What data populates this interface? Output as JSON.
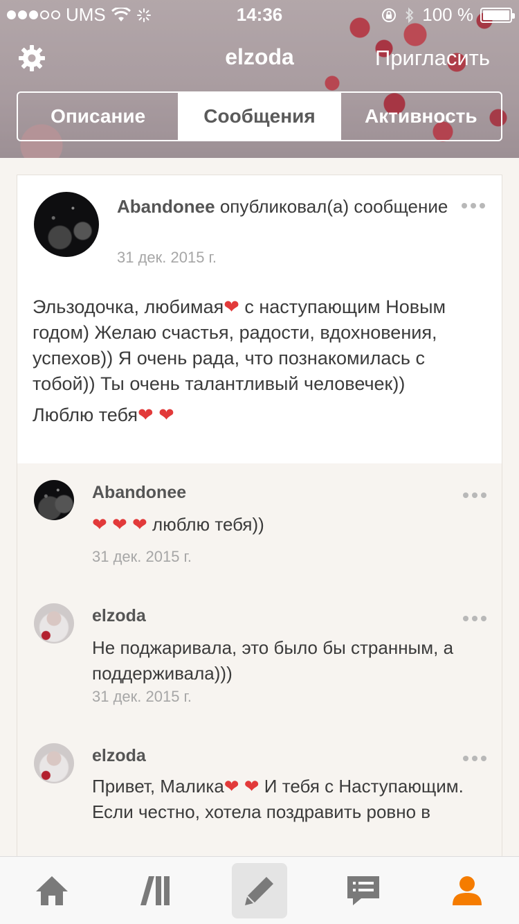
{
  "status_bar": {
    "carrier": "UMS",
    "time": "14:36",
    "battery": "100 %",
    "signal_bars_filled": 3,
    "signal_bars_total": 5
  },
  "nav": {
    "title": "elzoda",
    "invite_label": "Пригласить",
    "settings_icon": "gear-icon"
  },
  "tabs": [
    {
      "label": "Описание"
    },
    {
      "label": "Сообщения"
    },
    {
      "label": "Активность"
    }
  ],
  "post": {
    "author": "Abandonee",
    "action": "опубликовал(а) сообщение",
    "date": "31 дек. 2015 г.",
    "body_line1_a": "Эльзодочка, любимая",
    "body_line1_b": " с наступающим Новым годом) Желаю счастья, радости, вдохновения, успехов)) Я очень рада, что познакомилась с тобой)) Ты очень талантливый человечек))",
    "body_line2": "Люблю тебя",
    "heart": "❤"
  },
  "comments": [
    {
      "author": "Abandonee",
      "text_prefix": "❤ ❤ ❤",
      "text": " люблю тебя))",
      "date": "31 дек. 2015 г."
    },
    {
      "author": "elzoda",
      "text": "Не поджаривала, это было бы странным, а поддерживала)))",
      "date": "31 дек. 2015 г."
    },
    {
      "author": "elzoda",
      "text_a": "Привет, Малика",
      "text_hearts": "❤ ❤",
      "text_b": " И тебя с Наступающим. Если честно, хотела поздравить ровно в"
    }
  ],
  "tabbar": {
    "icons": [
      "home-icon",
      "library-icon",
      "compose-icon",
      "messages-icon",
      "profile-icon"
    ],
    "active_color": "#f57c00"
  }
}
